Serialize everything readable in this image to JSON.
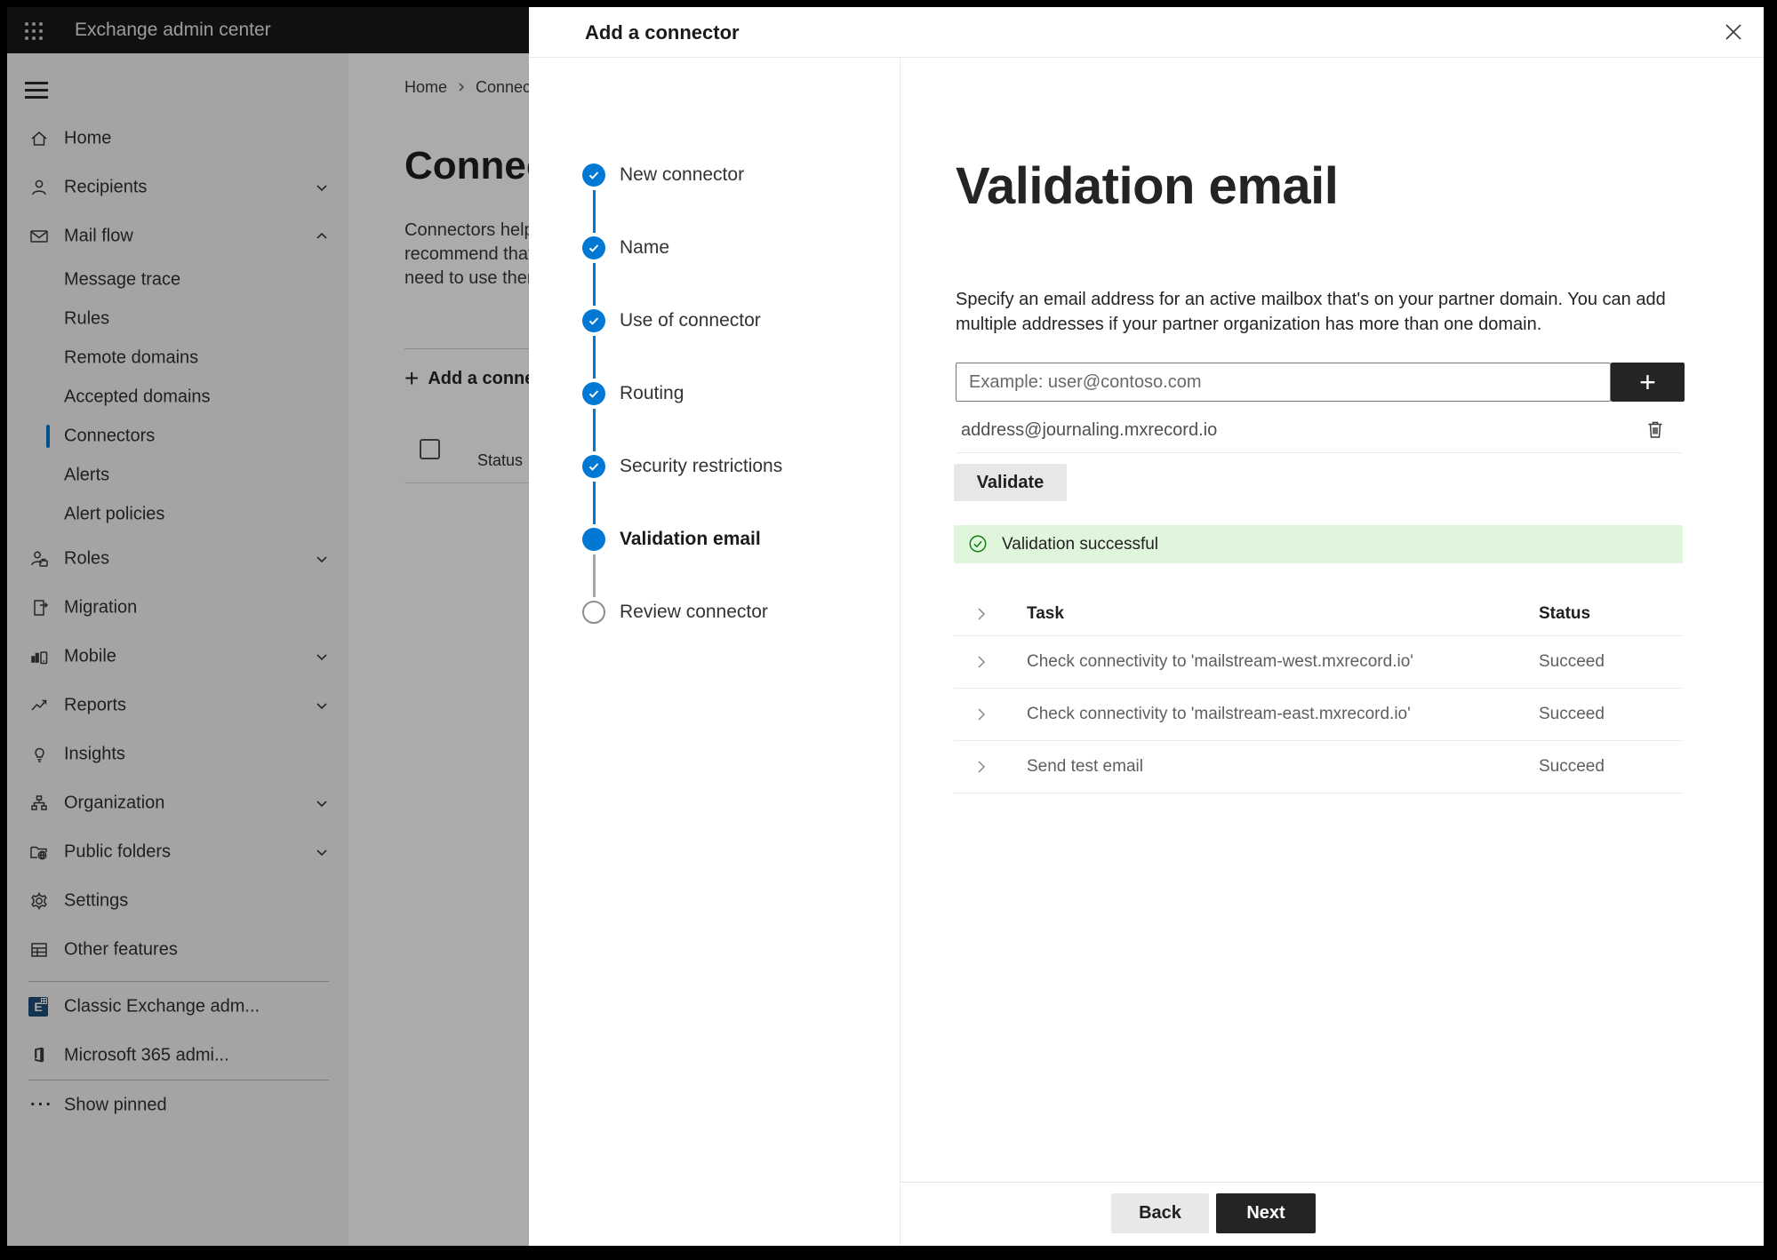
{
  "top_bar": {
    "title": "Exchange admin center"
  },
  "sidebar": {
    "items": [
      {
        "label": "Home",
        "icon": "home-icon",
        "type": "top"
      },
      {
        "label": "Recipients",
        "icon": "person-icon",
        "type": "top",
        "chevron": "down"
      },
      {
        "label": "Mail flow",
        "icon": "mail-icon",
        "type": "top",
        "chevron": "up",
        "expanded": true
      },
      {
        "label": "Message trace",
        "type": "sub"
      },
      {
        "label": "Rules",
        "type": "sub"
      },
      {
        "label": "Remote domains",
        "type": "sub"
      },
      {
        "label": "Accepted domains",
        "type": "sub"
      },
      {
        "label": "Connectors",
        "type": "sub",
        "selected": true
      },
      {
        "label": "Alerts",
        "type": "sub"
      },
      {
        "label": "Alert policies",
        "type": "sub"
      },
      {
        "label": "Roles",
        "icon": "roles-icon",
        "type": "top",
        "chevron": "down"
      },
      {
        "label": "Migration",
        "icon": "migration-icon",
        "type": "top"
      },
      {
        "label": "Mobile",
        "icon": "mobile-icon",
        "type": "top",
        "chevron": "down"
      },
      {
        "label": "Reports",
        "icon": "reports-icon",
        "type": "top",
        "chevron": "down"
      },
      {
        "label": "Insights",
        "icon": "insights-icon",
        "type": "top"
      },
      {
        "label": "Organization",
        "icon": "organization-icon",
        "type": "top",
        "chevron": "down"
      },
      {
        "label": "Public folders",
        "icon": "public-folders-icon",
        "type": "top",
        "chevron": "down"
      },
      {
        "label": "Settings",
        "icon": "settings-icon",
        "type": "top"
      },
      {
        "label": "Other features",
        "icon": "other-features-icon",
        "type": "top"
      }
    ],
    "footer_items": [
      {
        "label": "Classic Exchange adm...",
        "icon": "classic-exchange-icon"
      },
      {
        "label": "Microsoft 365 admi...",
        "icon": "microsoft-365-icon"
      }
    ],
    "show_pinned_label": "Show pinned"
  },
  "background_page": {
    "breadcrumb": {
      "home": "Home",
      "current": "Connectors"
    },
    "title": "Connectors",
    "description_lines": [
      "Connectors help your",
      "recommend that you",
      "need to use them"
    ],
    "add_button_label": "Add a connector",
    "status_column": "Status"
  },
  "panel": {
    "title": "Add a connector",
    "steps": [
      {
        "label": "New connector",
        "state": "completed"
      },
      {
        "label": "Name",
        "state": "completed"
      },
      {
        "label": "Use of connector",
        "state": "completed"
      },
      {
        "label": "Routing",
        "state": "completed"
      },
      {
        "label": "Security restrictions",
        "state": "completed"
      },
      {
        "label": "Validation email",
        "state": "current"
      },
      {
        "label": "Review connector",
        "state": "upcoming"
      }
    ],
    "content": {
      "heading": "Validation email",
      "description": "Specify an email address for an active mailbox that's on your partner domain. You can add multiple addresses if your partner organization has more than one domain.",
      "input_placeholder": "Example: user@contoso.com",
      "input_value": "",
      "address": "address@journaling.mxrecord.io",
      "validate_button": "Validate",
      "success_message": "Validation successful",
      "table": {
        "columns": {
          "task": "Task",
          "status": "Status"
        },
        "rows": [
          {
            "task": "Check connectivity to 'mailstream-west.mxrecord.io'",
            "status": "Succeed"
          },
          {
            "task": "Check connectivity to 'mailstream-east.mxrecord.io'",
            "status": "Succeed"
          },
          {
            "task": "Send test email",
            "status": "Succeed"
          }
        ]
      }
    },
    "footer": {
      "back_button": "Back",
      "next_button": "Next"
    }
  },
  "colors": {
    "accent_blue": "#0078d4",
    "success_background": "#dff6dd",
    "success_green": "#107c10",
    "primary_button": "#252423",
    "top_bar": "#1a1918"
  }
}
